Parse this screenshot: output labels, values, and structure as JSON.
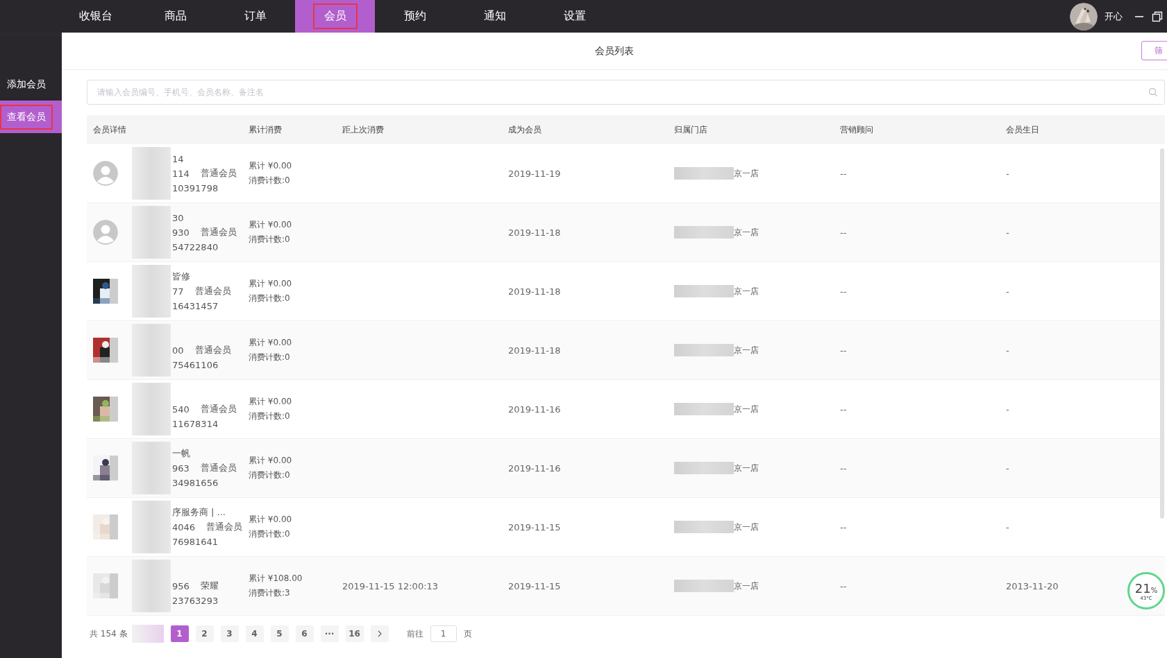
{
  "nav": {
    "items": [
      {
        "label": "收银台",
        "selected": false
      },
      {
        "label": "商品",
        "selected": false
      },
      {
        "label": "订单",
        "selected": false
      },
      {
        "label": "会员",
        "selected": true
      },
      {
        "label": "预约",
        "selected": false
      },
      {
        "label": "通知",
        "selected": false
      },
      {
        "label": "设置",
        "selected": false
      }
    ],
    "user": {
      "name": "开心"
    }
  },
  "sidebar": {
    "items": [
      {
        "label": "添加会员",
        "selected": false
      },
      {
        "label": "查看会员",
        "selected": true
      }
    ]
  },
  "page_title": "会员列表",
  "filter_button": "筛",
  "search": {
    "placeholder": "请输入会员编号、手机号、会员名称、备注名"
  },
  "table": {
    "columns": [
      "会员详情",
      "累计消费",
      "距上次消费",
      "成为会员",
      "归属门店",
      "营销顾问",
      "会员生日"
    ],
    "rows": [
      {
        "kind": "default",
        "name": "14",
        "id": "114",
        "level": "普通会员",
        "phone": "10391798",
        "total": "累计 ¥0.00",
        "count": "消费计数:0",
        "joined": "2019-11-19",
        "store": "京一店",
        "advisor": "--",
        "birthday": "-"
      },
      {
        "kind": "default",
        "name": "30",
        "id": "930",
        "level": "普通会员",
        "phone": "54722840",
        "total": "累计 ¥0.00",
        "count": "消费计数:0",
        "joined": "2019-11-18",
        "store": "京一店",
        "advisor": "--",
        "birthday": "-"
      },
      {
        "name": "皆修",
        "id": "77",
        "level": "普通会员",
        "phone": "16431457",
        "total": "累计 ¥0.00",
        "count": "消费计数:0",
        "joined": "2019-11-18",
        "store": "京一店",
        "advisor": "--",
        "birthday": "-"
      },
      {
        "id": "00",
        "level": "普通会员",
        "phone": "75461106",
        "total": "累计 ¥0.00",
        "count": "消费计数:0",
        "joined": "2019-11-18",
        "store": "京一店",
        "advisor": "--",
        "birthday": "-"
      },
      {
        "id": "540",
        "level": "普通会员",
        "phone": "11678314",
        "total": "累计 ¥0.00",
        "count": "消费计数:0",
        "joined": "2019-11-16",
        "store": "京一店",
        "advisor": "--",
        "birthday": "-"
      },
      {
        "name": "一帆",
        "id": "963",
        "level": "普通会员",
        "phone": "34981656",
        "total": "累计 ¥0.00",
        "count": "消费计数:0",
        "joined": "2019-11-16",
        "store": "京一店",
        "advisor": "--",
        "birthday": "-"
      },
      {
        "name": "序服务商 | ...",
        "id": "4046",
        "level": "普通会员",
        "phone": "76981641",
        "total": "累计 ¥0.00",
        "count": "消费计数:0",
        "joined": "2019-11-15",
        "store": "京一店",
        "advisor": "--",
        "birthday": "-"
      },
      {
        "id": "956",
        "level": "荣耀",
        "phone": "23763293",
        "total": "累计 ¥108.00",
        "count": "消费计数:3",
        "last": "2019-11-15 12:00:13",
        "joined": "2019-11-15",
        "store": "京一店",
        "advisor": "--",
        "birthday": "2013-11-20"
      }
    ]
  },
  "pagination": {
    "total": "共 154 条",
    "pages": [
      {
        "label": "1",
        "selected": true
      },
      {
        "label": "2",
        "selected": false
      },
      {
        "label": "3",
        "selected": false
      },
      {
        "label": "4",
        "selected": false
      },
      {
        "label": "5",
        "selected": false
      },
      {
        "label": "6",
        "selected": false
      },
      {
        "label": "···",
        "selected": false
      },
      {
        "label": "16",
        "selected": false
      }
    ],
    "goto_label": "前往",
    "goto_value": "1",
    "goto_suffix": "页"
  },
  "monitor": {
    "percent": "21",
    "unit": "%",
    "temperature": "43°C"
  }
}
